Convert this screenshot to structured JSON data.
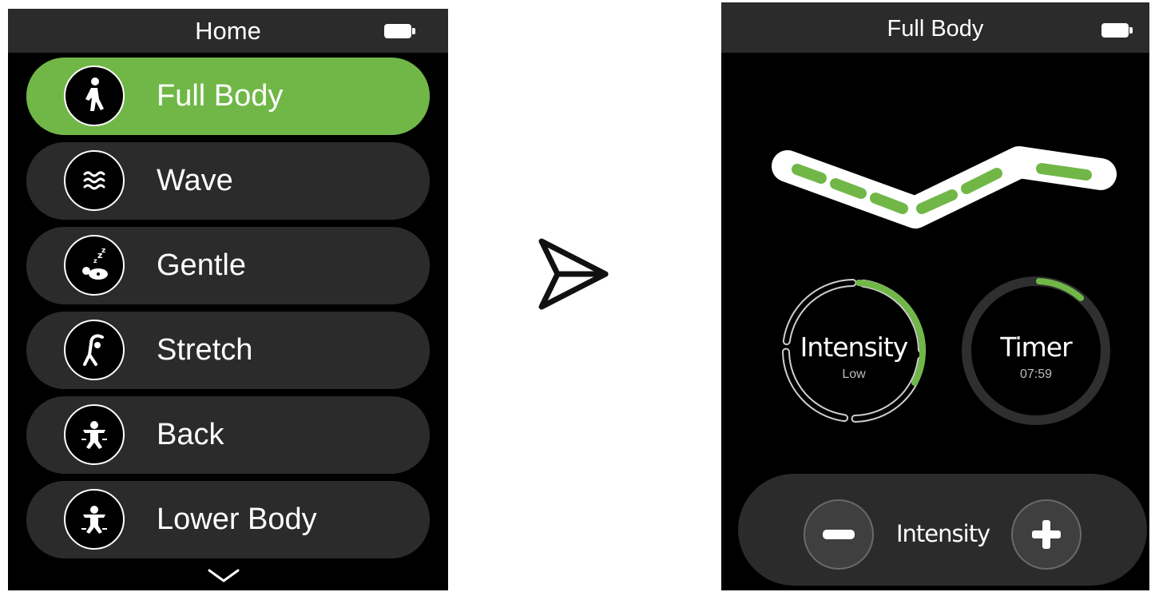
{
  "home_screen": {
    "title": "Home",
    "menu_items": [
      {
        "label": "Full Body",
        "icon": "walking-person-icon",
        "selected": true
      },
      {
        "label": "Wave",
        "icon": "wave-icon",
        "selected": false
      },
      {
        "label": "Gentle",
        "icon": "sleeping-person-icon",
        "selected": false
      },
      {
        "label": "Stretch",
        "icon": "stretching-person-icon",
        "selected": false
      },
      {
        "label": "Back",
        "icon": "back-massage-icon",
        "selected": false
      },
      {
        "label": "Lower Body",
        "icon": "lower-body-massage-icon",
        "selected": false
      }
    ],
    "more_indicator": "chevron-down-icon"
  },
  "transition_icon": "send-arrow-icon",
  "detail_screen": {
    "title": "Full Body",
    "intensity_dial": {
      "title": "Intensity",
      "value": "Low"
    },
    "timer_dial": {
      "title": "Timer",
      "value": "07:59"
    },
    "control": {
      "label": "Intensity",
      "minus_icon": "minus-icon",
      "plus_icon": "plus-icon"
    }
  },
  "colors": {
    "accent": "#71b748",
    "screen_bg": "#000000",
    "panel": "#2b2b2b",
    "text": "#ffffff"
  }
}
